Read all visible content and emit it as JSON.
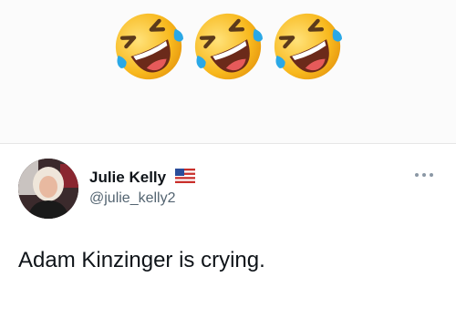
{
  "emojis": [
    {
      "icon": "rolling-on-floor-laughing-emoji"
    },
    {
      "icon": "rolling-on-floor-laughing-emoji"
    },
    {
      "icon": "rolling-on-floor-laughing-emoji"
    }
  ],
  "tweet": {
    "display_name": "Julie Kelly",
    "flag_icon": "us-flag-icon",
    "handle": "@julie_kelly2",
    "text": "Adam Kinzinger is crying.",
    "more_icon": "more-options-icon"
  },
  "colors": {
    "text_primary": "#0f1419",
    "text_secondary": "#536471",
    "emoji_face": "#f8b91e",
    "tear_blue": "#2aa8e6"
  }
}
